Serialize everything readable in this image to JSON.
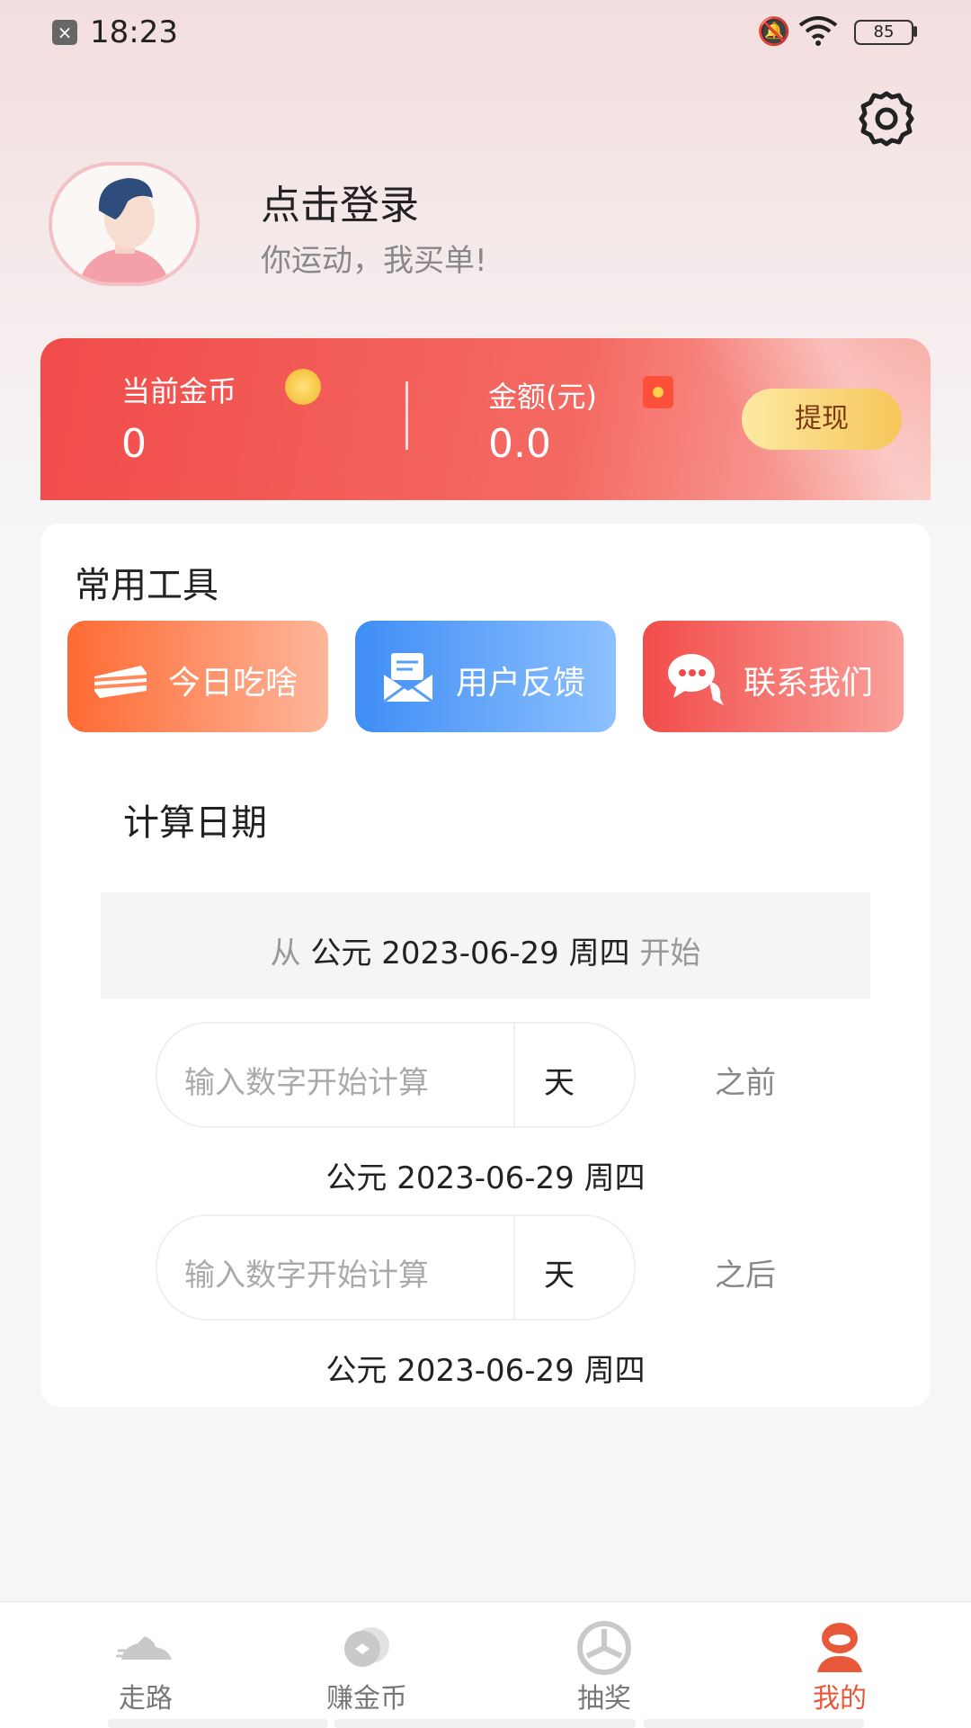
{
  "status_bar": {
    "time": "18:23",
    "battery": "85"
  },
  "profile": {
    "login_title": "点击登录",
    "login_subtitle": "你运动，我买单!"
  },
  "wallet": {
    "coins_label": "当前金币",
    "coins_value": "0",
    "amount_label": "金额(元)",
    "amount_value": "0.0",
    "withdraw_label": "提现"
  },
  "tools": {
    "title": "常用工具",
    "items": [
      {
        "label": "今日吃啥",
        "icon": "cake-icon"
      },
      {
        "label": "用户反馈",
        "icon": "feedback-envelope-icon"
      },
      {
        "label": "联系我们",
        "icon": "chat-bubble-icon"
      }
    ]
  },
  "date_calc": {
    "title": "计算日期",
    "from_prefix": "从",
    "from_date": "公元 2023-06-29 周四",
    "from_suffix": "开始",
    "before": {
      "placeholder": "输入数字开始计算",
      "unit": "天",
      "relation": "之前",
      "result": "公元 2023-06-29 周四"
    },
    "after": {
      "placeholder": "输入数字开始计算",
      "unit": "天",
      "relation": "之后",
      "result": "公元 2023-06-29 周四"
    }
  },
  "nav": {
    "items": [
      {
        "label": "走路",
        "icon": "running-shoe-icon",
        "active": false
      },
      {
        "label": "赚金币",
        "icon": "coin-icon",
        "active": false
      },
      {
        "label": "抽奖",
        "icon": "lottery-wheel-icon",
        "active": false
      },
      {
        "label": "我的",
        "icon": "profile-icon",
        "active": true
      }
    ]
  },
  "colors": {
    "accent": "#f14b4a",
    "nav_active": "#e8583a",
    "tool_orange": "#ff6a33",
    "tool_blue": "#3f8df5",
    "tool_red": "#f24c4a"
  }
}
